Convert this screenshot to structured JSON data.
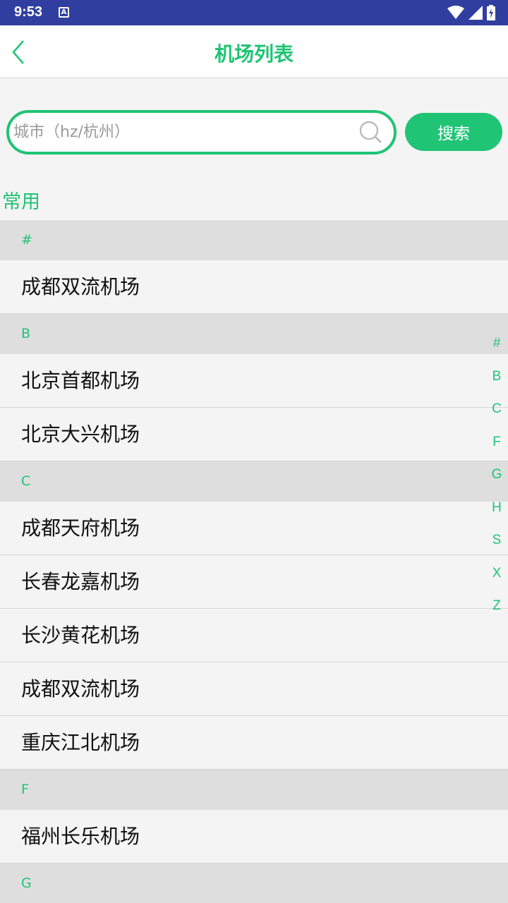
{
  "status_bar": {
    "time": "9:53",
    "notification_icon": "A"
  },
  "header": {
    "title": "机场列表"
  },
  "search": {
    "placeholder": "城市（hz/杭州）",
    "value": "",
    "button_label": "搜索"
  },
  "common_label": "常用",
  "sections": [
    {
      "letter": "#",
      "items": [
        "成都双流机场"
      ]
    },
    {
      "letter": "B",
      "items": [
        "北京首都机场",
        "北京大兴机场"
      ]
    },
    {
      "letter": "C",
      "items": [
        "成都天府机场",
        "长春龙嘉机场",
        "长沙黄花机场",
        "成都双流机场",
        "重庆江北机场"
      ]
    },
    {
      "letter": "F",
      "items": [
        "福州长乐机场"
      ]
    },
    {
      "letter": "G",
      "items": []
    }
  ],
  "index_letters": [
    "#",
    "B",
    "C",
    "F",
    "G",
    "H",
    "S",
    "X",
    "Z"
  ],
  "colors": {
    "accent": "#1fc474",
    "status_bar": "#303f9f",
    "section_bg": "#dedede",
    "page_bg": "#f4f4f4"
  }
}
